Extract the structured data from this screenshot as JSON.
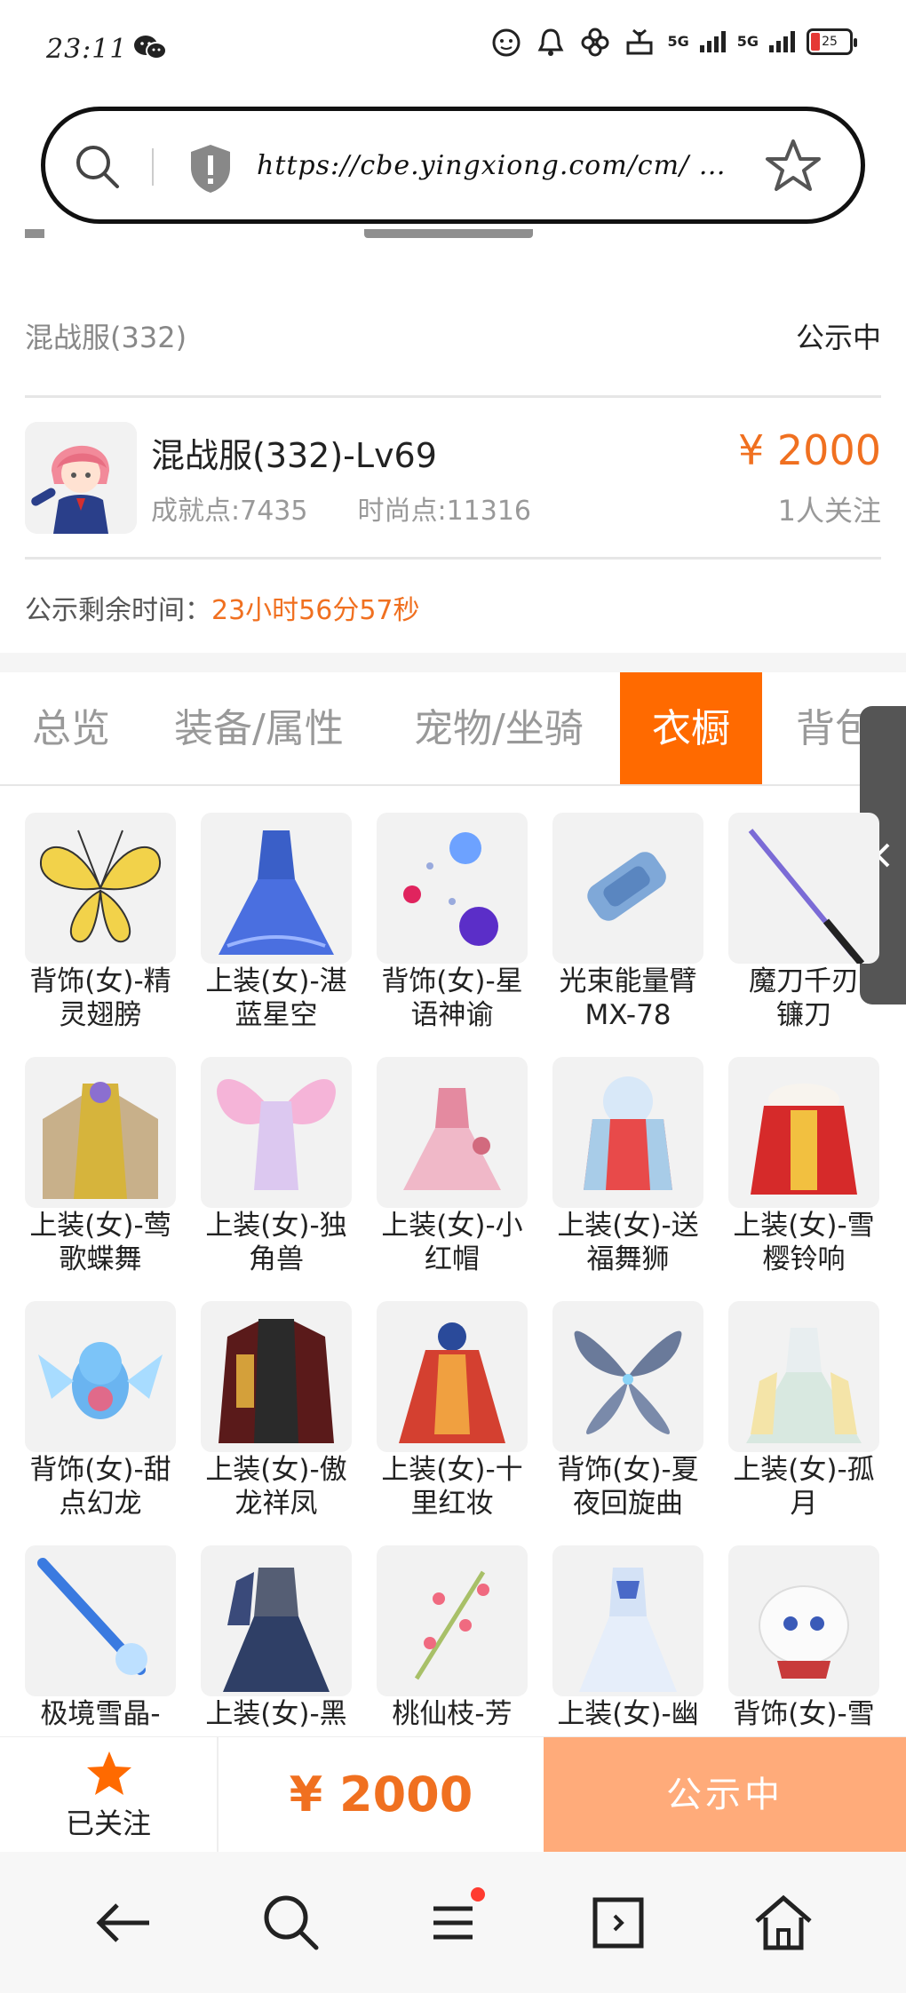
{
  "status_bar": {
    "time": "23:11",
    "signal1": "5G",
    "signal2": "5G",
    "battery": "25"
  },
  "url_bar": {
    "url": "https://cbe.yingxiong.com/cm/ …"
  },
  "listing": {
    "server": "混战服(332)",
    "status": "公示中",
    "role_title": "混战服(332)-Lv69",
    "achievement": "成就点:7435",
    "fashion": "时尚点:11316",
    "price": "¥ 2000",
    "followers": "1人关注",
    "countdown_label": "公示剩余时间：",
    "countdown_value": "23小时56分57秒"
  },
  "tabs": [
    {
      "label": "总览"
    },
    {
      "label": "装备/属性"
    },
    {
      "label": "宠物/坐骑"
    },
    {
      "label": "衣橱",
      "active": true
    },
    {
      "label": "背包"
    }
  ],
  "wardrobe": [
    {
      "line1": "背饰(女)-精",
      "line2": "灵翅膀"
    },
    {
      "line1": "上装(女)-湛",
      "line2": "蓝星空"
    },
    {
      "line1": "背饰(女)-星",
      "line2": "语神谕"
    },
    {
      "line1": "光束能量臂",
      "line2": "MX-78"
    },
    {
      "line1": "魔刀千刃",
      "line2": "镰刀"
    },
    {
      "line1": "上装(女)-莺",
      "line2": "歌蝶舞"
    },
    {
      "line1": "上装(女)-独",
      "line2": "角兽"
    },
    {
      "line1": "上装(女)-小",
      "line2": "红帽"
    },
    {
      "line1": "上装(女)-送",
      "line2": "福舞狮"
    },
    {
      "line1": "上装(女)-雪",
      "line2": "樱铃响"
    },
    {
      "line1": "背饰(女)-甜",
      "line2": "点幻龙"
    },
    {
      "line1": "上装(女)-傲",
      "line2": "龙祥凤"
    },
    {
      "line1": "上装(女)-十",
      "line2": "里红妆"
    },
    {
      "line1": "背饰(女)-夏",
      "line2": "夜回旋曲"
    },
    {
      "line1": "上装(女)-孤",
      "line2": "月"
    },
    {
      "line1": "极境雪晶-",
      "line2": ""
    },
    {
      "line1": "上装(女)-黑",
      "line2": ""
    },
    {
      "line1": "桃仙枝-芳",
      "line2": ""
    },
    {
      "line1": "上装(女)-幽",
      "line2": ""
    },
    {
      "line1": "背饰(女)-雪",
      "line2": ""
    }
  ],
  "action_bar": {
    "follow_label": "已关注",
    "price": "¥ 2000",
    "button": "公示中"
  },
  "colors": {
    "accent": "#ff6a00",
    "price": "#f07020",
    "button_disabled": "#ffab7a"
  }
}
